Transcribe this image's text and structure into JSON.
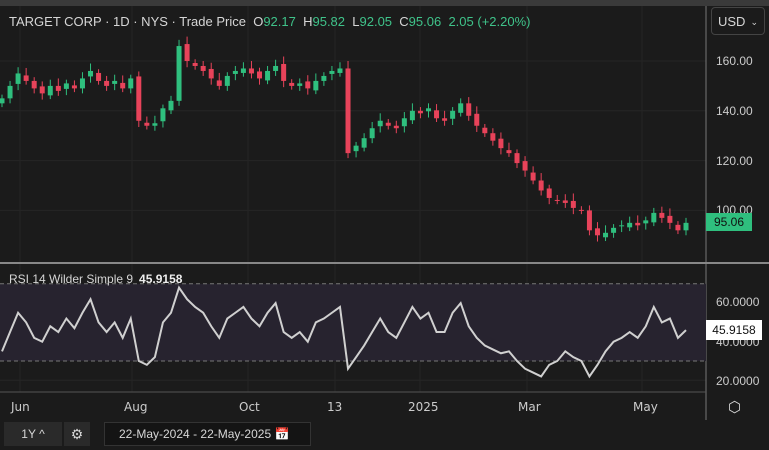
{
  "header": {
    "name": "TARGET CORP · 1D · NYS · Trade Price",
    "o_label": "O",
    "o": "92.17",
    "h_label": "H",
    "h": "95.82",
    "l_label": "L",
    "l": "92.05",
    "c_label": "C",
    "c": "95.06",
    "change": "2.05 (+2.20%)"
  },
  "currency": {
    "value": "USD"
  },
  "price_axis": [
    "160.00",
    "140.00",
    "120.00",
    "100.00"
  ],
  "last_price": "95.06",
  "rsi": {
    "label": "RSI 14 Wilder Simple 9",
    "value": "45.9158",
    "axis": [
      "60.0000",
      "40.0000",
      "20.0000"
    ]
  },
  "x_axis": [
    "Jun",
    "Aug",
    "Oct",
    "13",
    "2025",
    "Mar",
    "May"
  ],
  "footer": {
    "period": "1Y",
    "date_from": "22-May-2024",
    "sep": "-",
    "date_to": "22-May-2025"
  },
  "colors": {
    "up": "#2fbf7e",
    "down": "#e8435a",
    "rsi_line": "#d0d0d0",
    "band": "#27232f"
  },
  "chart_data": {
    "type": "candlestick",
    "price_range": [
      85,
      170
    ],
    "closes": [
      145,
      150,
      155,
      152,
      149,
      147,
      150,
      148,
      151,
      149,
      153,
      156,
      152,
      150,
      152,
      149,
      153,
      136,
      134,
      135,
      141,
      144,
      166,
      160,
      158,
      156,
      153,
      150,
      154,
      156,
      157,
      155,
      153,
      156,
      158,
      152,
      150,
      151,
      149,
      152,
      154,
      156,
      157,
      123,
      126,
      129,
      133,
      136,
      134,
      133,
      137,
      140,
      139,
      141,
      137,
      136,
      140,
      143,
      138,
      134,
      131,
      128,
      125,
      123,
      119,
      116,
      112,
      108,
      105,
      104,
      103,
      101,
      100,
      92,
      90,
      91,
      93,
      94,
      95,
      94,
      96,
      99,
      97,
      95,
      92,
      95
    ],
    "rsi_values": [
      35,
      45,
      55,
      50,
      42,
      40,
      48,
      45,
      52,
      47,
      55,
      62,
      50,
      45,
      50,
      42,
      52,
      30,
      28,
      32,
      50,
      55,
      68,
      62,
      58,
      55,
      48,
      42,
      52,
      55,
      58,
      52,
      48,
      55,
      60,
      45,
      42,
      45,
      40,
      50,
      52,
      55,
      58,
      26,
      32,
      38,
      45,
      52,
      45,
      42,
      50,
      58,
      52,
      55,
      45,
      45,
      55,
      60,
      48,
      42,
      38,
      36,
      34,
      35,
      30,
      26,
      24,
      22,
      28,
      30,
      35,
      32,
      30,
      22,
      28,
      35,
      40,
      42,
      45,
      42,
      48,
      58,
      50,
      52,
      42,
      46
    ],
    "rsi_band": [
      30,
      70
    ]
  }
}
